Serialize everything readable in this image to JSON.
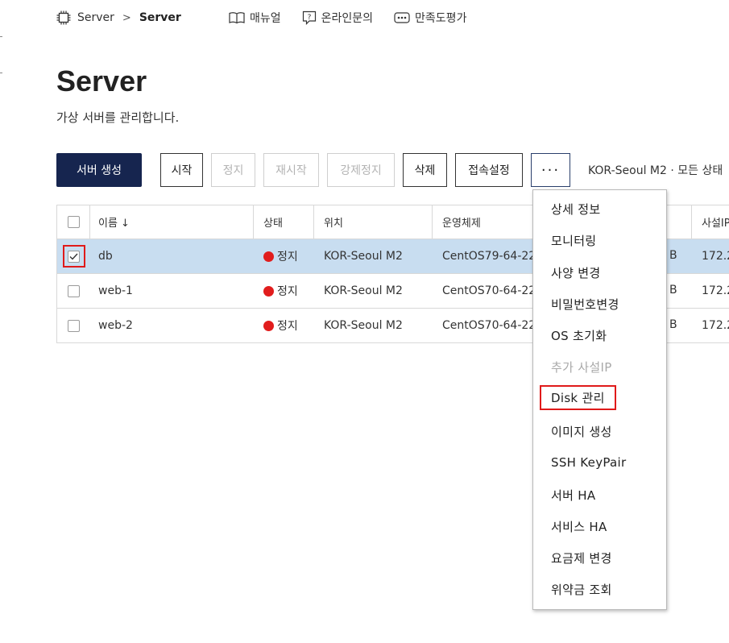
{
  "breadcrumb": {
    "root": "Server",
    "separator": ">",
    "current": "Server",
    "icon": "chip-icon"
  },
  "top_links": [
    {
      "label": "매뉴얼",
      "icon": "book-icon"
    },
    {
      "label": "온라인문의",
      "icon": "question-icon"
    },
    {
      "label": "만족도평가",
      "icon": "chat-icon"
    }
  ],
  "page": {
    "title": "Server",
    "description": "가상 서버를 관리합니다."
  },
  "toolbar": {
    "create": "서버 생성",
    "start": "시작",
    "stop": "정지",
    "restart": "재시작",
    "force_stop": "강제정지",
    "delete": "삭제",
    "access": "접속설정",
    "more": "···",
    "filter_text": "KOR-Seoul M2 · 모든 상태"
  },
  "table": {
    "columns": [
      "이름 ↓",
      "상태",
      "위치",
      "운영체제",
      "사설IP"
    ],
    "rows": [
      {
        "name": "db",
        "state": "정지",
        "location": "KOR-Seoul M2",
        "os": "CentOS79-64-22",
        "size_suffix": "B",
        "ip": "172.2",
        "checked": true
      },
      {
        "name": "web-1",
        "state": "정지",
        "location": "KOR-Seoul M2",
        "os": "CentOS70-64-22",
        "size_suffix": "B",
        "ip": "172.2",
        "checked": false
      },
      {
        "name": "web-2",
        "state": "정지",
        "location": "KOR-Seoul M2",
        "os": "CentOS70-64-22",
        "size_suffix": "B",
        "ip": "172.2",
        "checked": false
      }
    ]
  },
  "menu": {
    "items": [
      {
        "label": "상세 정보",
        "disabled": false
      },
      {
        "label": "모니터링",
        "disabled": false
      },
      {
        "label": "사양 변경",
        "disabled": false
      },
      {
        "label": "비밀번호변경",
        "disabled": false
      },
      {
        "label": "OS 초기화",
        "disabled": false
      },
      {
        "label": "추가 사설IP",
        "disabled": true
      },
      {
        "label": "Disk 관리",
        "disabled": false,
        "highlighted": true
      },
      {
        "label": "이미지 생성",
        "disabled": false
      },
      {
        "label": "SSH KeyPair",
        "disabled": false
      },
      {
        "label": "서버 HA",
        "disabled": false
      },
      {
        "label": "서비스 HA",
        "disabled": false
      },
      {
        "label": "요금제 변경",
        "disabled": false
      },
      {
        "label": "위약금 조회",
        "disabled": false
      }
    ]
  },
  "colors": {
    "primary": "#16254f",
    "selected_row": "#c8ddf0",
    "status_stopped": "#e11d1d",
    "highlight": "#e01a1a"
  }
}
